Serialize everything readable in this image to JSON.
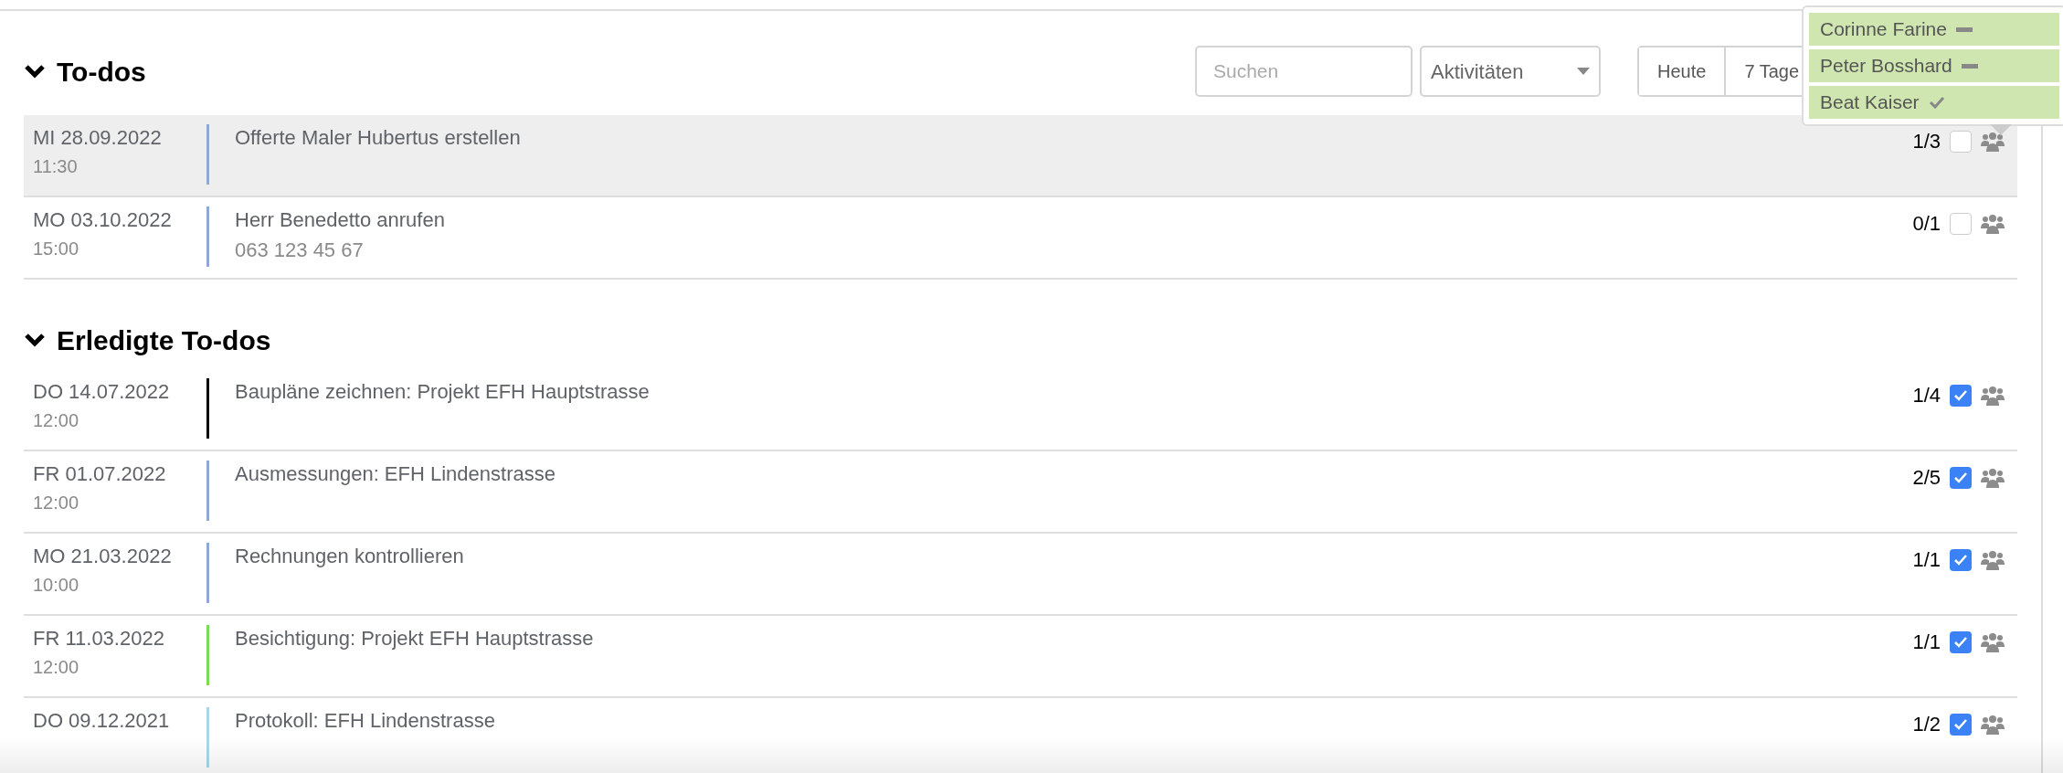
{
  "toolbar": {
    "search": {
      "placeholder": "Suchen"
    },
    "filter": {
      "value": "Aktivitäten"
    },
    "range_buttons": [
      {
        "label": "Heute",
        "selected": false
      },
      {
        "label": "7 Tage",
        "selected": false
      }
    ]
  },
  "assignee_popup": [
    {
      "name": "Corinne Farine",
      "done": false
    },
    {
      "name": "Peter Bosshard",
      "done": false
    },
    {
      "name": "Beat Kaiser",
      "done": true
    }
  ],
  "sections": [
    {
      "title": "To-dos",
      "expanded": true,
      "rows": [
        {
          "date": "MI 28.09.2022",
          "time": "11:30",
          "title": "Offerte Maler Hubertus erstellen",
          "color": "#8fa8d8",
          "count": "1/3",
          "checked": false,
          "selected": true
        },
        {
          "date": "MO 03.10.2022",
          "time": "15:00",
          "title": "Herr Benedetto anrufen",
          "subtitle": "063 123 45 67",
          "color": "#8fa8d8",
          "count": "0/1",
          "checked": false,
          "selected": false
        }
      ]
    },
    {
      "title": "Erledigte To-dos",
      "expanded": true,
      "rows": [
        {
          "date": "DO 14.07.2022",
          "time": "12:00",
          "title": "Baupläne zeichnen: Projekt EFH Hauptstrasse",
          "color": "#000000",
          "count": "1/4",
          "checked": true,
          "selected": false
        },
        {
          "date": "FR 01.07.2022",
          "time": "12:00",
          "title": "Ausmessungen: EFH Lindenstrasse",
          "color": "#8fa8d8",
          "count": "2/5",
          "checked": true,
          "selected": false
        },
        {
          "date": "MO 21.03.2022",
          "time": "10:00",
          "title": "Rechnungen kontrollieren",
          "color": "#8fa8d8",
          "count": "1/1",
          "checked": true,
          "selected": false
        },
        {
          "date": "FR 11.03.2022",
          "time": "12:00",
          "title": "Besichtigung: Projekt EFH Hauptstrasse",
          "color": "#7ed957",
          "count": "1/1",
          "checked": true,
          "selected": false
        },
        {
          "date": "DO 09.12.2021",
          "title": "Protokoll: EFH Lindenstrasse",
          "color": "#a8d8e8",
          "count": "1/2",
          "checked": true,
          "selected": false
        }
      ]
    }
  ]
}
